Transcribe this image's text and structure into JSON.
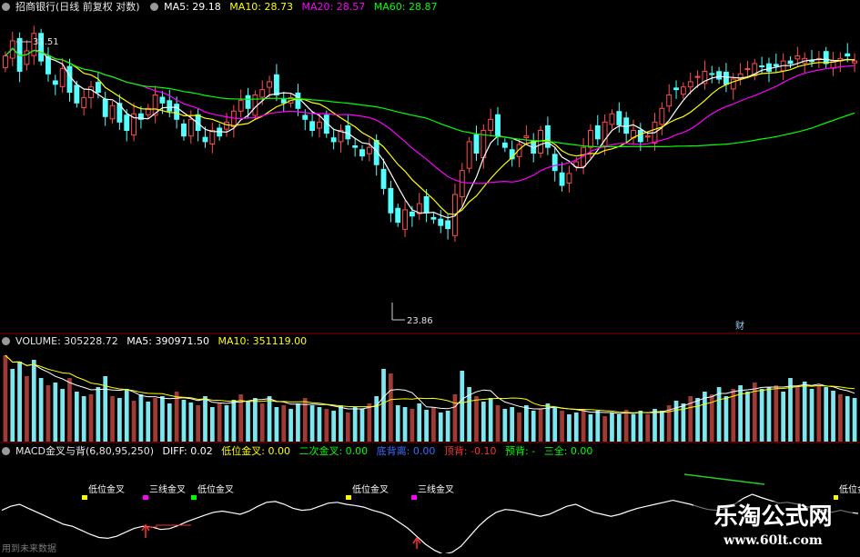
{
  "price_header": {
    "stock": "招商银行(日线 前复权 对数)",
    "ma5": "MA5: 29.18",
    "ma10": "MA10: 28.73",
    "ma20": "MA20: 28.57",
    "ma60": "MA60: 28.87"
  },
  "volume_header": {
    "title": "VOLUME: 305228.72",
    "ma5": "MA5: 390971.50",
    "ma10": "MA10: 351119.00"
  },
  "macd_header": {
    "title": "MACD金叉与背(6,80,95,250)",
    "diff": "DIFF: 0.02",
    "low_cross": "低位金叉: 0.00",
    "second_cross": "二次金叉: 0.00",
    "bottom_div": "底背离: 0.00",
    "top_div": "顶背: -0.10",
    "pre_div": "预背: -",
    "triple": "三全: 0.00"
  },
  "annotations": {
    "high_price": "31.51",
    "low_price": "23.86",
    "finance_marker": "财",
    "future_data": "用到未来数据"
  },
  "signal_labels": {
    "low_cross": "低位金叉",
    "triple_gold": "三线金叉"
  },
  "watermark": {
    "site_name": "乐淘公式网",
    "url": "www.60lt.com"
  },
  "colors": {
    "background": "#000000",
    "up_candle": "#ff4d4d",
    "down_candle": "#54ffff",
    "ma5": "#ffffff",
    "ma10": "#ffff00",
    "ma20": "#ff00ff",
    "ma60": "#00ff00",
    "divider": "#8b0000"
  },
  "chart_data": {
    "type": "candlestick",
    "price_axis": "log",
    "ylim": [
      23.5,
      32.0
    ],
    "closes": [
      30.4,
      31.0,
      29.8,
      30.6,
      31.3,
      30.2,
      29.7,
      29.3,
      29.9,
      29.0,
      28.6,
      28.8,
      29.2,
      29.0,
      28.1,
      28.5,
      27.9,
      27.6,
      28.2,
      28.0,
      28.4,
      28.9,
      28.6,
      28.3,
      28.0,
      27.4,
      28.0,
      27.6,
      27.2,
      27.6,
      27.4,
      27.9,
      28.3,
      28.7,
      28.4,
      28.9,
      29.1,
      29.4,
      28.9,
      28.6,
      28.8,
      28.4,
      28.0,
      27.6,
      27.9,
      27.5,
      27.2,
      27.6,
      27.3,
      27.0,
      26.7,
      27.0,
      26.4,
      25.6,
      24.8,
      24.5,
      24.9,
      24.7,
      25.1,
      24.8,
      24.6,
      24.4,
      24.3,
      25.4,
      26.2,
      27.2,
      26.8,
      27.6,
      28.0,
      27.4,
      27.0,
      26.6,
      27.1,
      27.4,
      26.8,
      27.6,
      27.0,
      26.2,
      25.7,
      26.1,
      26.5,
      27.0,
      27.6,
      27.3,
      27.9,
      28.2,
      27.8,
      27.5,
      27.6,
      27.2,
      27.4,
      27.9,
      28.4,
      28.9,
      29.1,
      29.2,
      29.4,
      29.6,
      29.8,
      29.7,
      29.5,
      29.3,
      29.5,
      29.7,
      29.9,
      30.1,
      30.0,
      29.8,
      30.0,
      30.2,
      30.1,
      30.4,
      30.3,
      30.2,
      30.3,
      30.1,
      30.2,
      30.3,
      30.4,
      30.2
    ],
    "high_label": 31.51,
    "low_label": 23.86,
    "volume": [
      0.95,
      0.8,
      0.88,
      0.72,
      0.9,
      0.7,
      0.62,
      0.65,
      0.58,
      0.7,
      0.55,
      0.5,
      0.52,
      0.6,
      0.72,
      0.5,
      0.48,
      0.58,
      0.45,
      0.52,
      0.44,
      0.48,
      0.5,
      0.42,
      0.55,
      0.46,
      0.43,
      0.4,
      0.5,
      0.38,
      0.42,
      0.4,
      0.46,
      0.52,
      0.44,
      0.48,
      0.42,
      0.5,
      0.38,
      0.4,
      0.36,
      0.42,
      0.48,
      0.4,
      0.38,
      0.36,
      0.34,
      0.4,
      0.32,
      0.38,
      0.36,
      0.42,
      0.5,
      0.8,
      0.75,
      0.4,
      0.38,
      0.36,
      0.42,
      0.35,
      0.38,
      0.32,
      0.34,
      0.52,
      0.78,
      0.6,
      0.5,
      0.44,
      0.48,
      0.4,
      0.36,
      0.38,
      0.32,
      0.4,
      0.34,
      0.36,
      0.42,
      0.38,
      0.34,
      0.3,
      0.32,
      0.36,
      0.3,
      0.34,
      0.28,
      0.32,
      0.3,
      0.35,
      0.3,
      0.34,
      0.3,
      0.36,
      0.34,
      0.4,
      0.45,
      0.42,
      0.5,
      0.48,
      0.55,
      0.52,
      0.6,
      0.5,
      0.58,
      0.62,
      0.55,
      0.65,
      0.58,
      0.6,
      0.62,
      0.55,
      0.7,
      0.6,
      0.66,
      0.58,
      0.62,
      0.6,
      0.56,
      0.52,
      0.5,
      0.48
    ],
    "macd_diff": [
      0.1,
      0.2,
      0.25,
      0.15,
      0.05,
      -0.05,
      -0.15,
      -0.25,
      -0.3,
      -0.4,
      -0.5,
      -0.58,
      -0.6,
      -0.55,
      -0.45,
      -0.35,
      -0.3,
      -0.32,
      -0.38,
      -0.36,
      -0.28,
      -0.18,
      -0.1,
      -0.02,
      0.05,
      0.08,
      0.04,
      0.0,
      0.08,
      0.2,
      0.3,
      0.32,
      0.25,
      0.15,
      0.1,
      0.12,
      0.2,
      0.28,
      0.3,
      0.25,
      0.22,
      0.18,
      0.1,
      0.04,
      -0.05,
      -0.2,
      -0.35,
      -0.55,
      -0.75,
      -0.9,
      -1.0,
      -0.95,
      -0.8,
      -0.55,
      -0.3,
      -0.1,
      0.05,
      0.12,
      0.1,
      0.05,
      0.0,
      -0.05,
      0.0,
      0.1,
      0.2,
      0.25,
      0.15,
      0.05,
      0.0,
      -0.05,
      0.0,
      0.08,
      0.15,
      0.2,
      0.25,
      0.3,
      0.35,
      0.3,
      0.25,
      0.18,
      0.12,
      0.1,
      0.15,
      0.25,
      0.4,
      0.5,
      0.42,
      0.35,
      0.28,
      0.3,
      0.26,
      0.2,
      0.15,
      0.1,
      0.05,
      0.1,
      0.05,
      0.02
    ],
    "series": [
      {
        "name": "MA5",
        "color": "#ffffff"
      },
      {
        "name": "MA10",
        "color": "#ffff00"
      },
      {
        "name": "MA20",
        "color": "#ff00ff"
      },
      {
        "name": "MA60",
        "color": "#00ff00"
      }
    ]
  }
}
